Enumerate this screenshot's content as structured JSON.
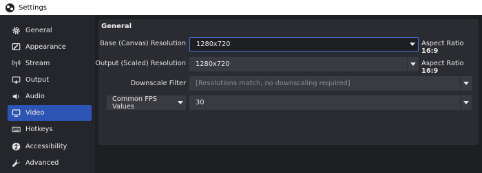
{
  "window": {
    "title": "Settings"
  },
  "sidebar": {
    "items": [
      {
        "label": "General",
        "icon": "gear-icon"
      },
      {
        "label": "Appearance",
        "icon": "appearance-icon"
      },
      {
        "label": "Stream",
        "icon": "antenna-icon"
      },
      {
        "label": "Output",
        "icon": "output-icon"
      },
      {
        "label": "Audio",
        "icon": "speaker-icon"
      },
      {
        "label": "Video",
        "icon": "monitor-icon"
      },
      {
        "label": "Hotkeys",
        "icon": "keyboard-icon"
      },
      {
        "label": "Accessibility",
        "icon": "accessibility-icon"
      },
      {
        "label": "Advanced",
        "icon": "wrench-icon"
      }
    ],
    "active": "Video"
  },
  "main": {
    "group_title": "General",
    "base_resolution": {
      "label": "Base (Canvas) Resolution",
      "value": "1280x720",
      "aspect_label": "Aspect Ratio",
      "aspect_value": "16:9"
    },
    "output_resolution": {
      "label": "Output (Scaled) Resolution",
      "value": "1280x720",
      "aspect_label": "Aspect Ratio",
      "aspect_value": "16:9"
    },
    "downscale_filter": {
      "label": "Downscale Filter",
      "value": "[Resolutions match, no downscaling required]"
    },
    "fps": {
      "type_label": "Common FPS Values",
      "value": "30"
    }
  },
  "colors": {
    "accent": "#2d55b5",
    "focus_border": "#4a76d8"
  }
}
